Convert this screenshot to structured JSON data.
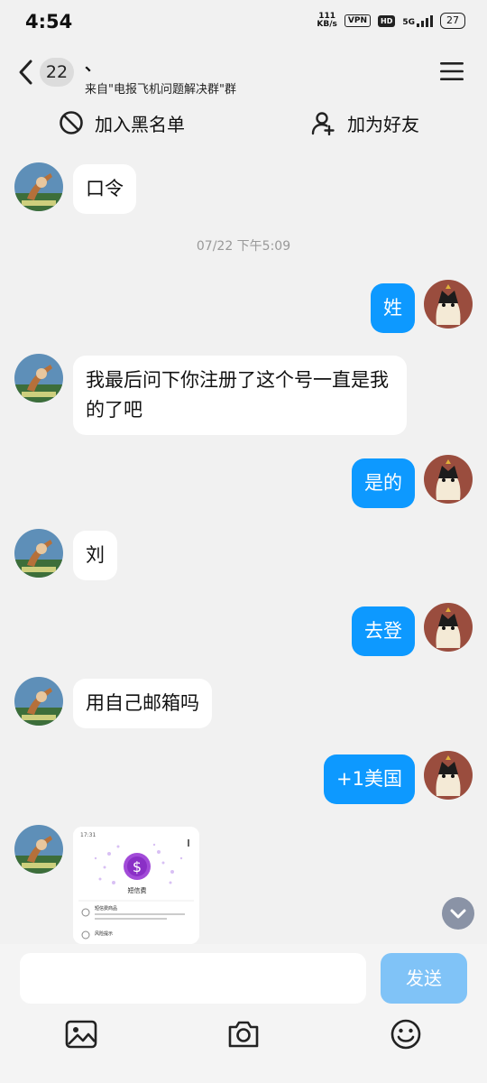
{
  "status_bar": {
    "time": "4:54",
    "net_speed_value": "111",
    "net_speed_unit": "KB/s",
    "vpn": "VPN",
    "hd": "HD",
    "network": "5G",
    "battery": "27"
  },
  "header": {
    "unread_count": "22",
    "chat_name": "、",
    "subtitle": "来自\"电报飞机问题解决群\"群"
  },
  "actions": {
    "block_label": "加入黑名单",
    "add_friend_label": "加为好友"
  },
  "messages": [
    {
      "side": "in",
      "text": "口令"
    },
    {
      "side": "time",
      "text": "07/22 下午5:09"
    },
    {
      "side": "out",
      "text": "姓"
    },
    {
      "side": "in",
      "text": "我最后问下你注册了这个号一直是我的了吧"
    },
    {
      "side": "out",
      "text": "是的"
    },
    {
      "side": "in",
      "text": "刘"
    },
    {
      "side": "out",
      "text": "去登"
    },
    {
      "side": "in",
      "text": "用自己邮箱吗"
    },
    {
      "side": "out",
      "text": "+1美国"
    }
  ],
  "image_message": {
    "time": "17:31",
    "title": "短信费",
    "line1": "短信费商品",
    "line2": "风险提示"
  },
  "input": {
    "placeholder": "",
    "send_label": "发送"
  },
  "colors": {
    "outgoing_bubble": "#0d99ff",
    "send_button": "#80c3f7",
    "background": "#f1f1f1"
  }
}
